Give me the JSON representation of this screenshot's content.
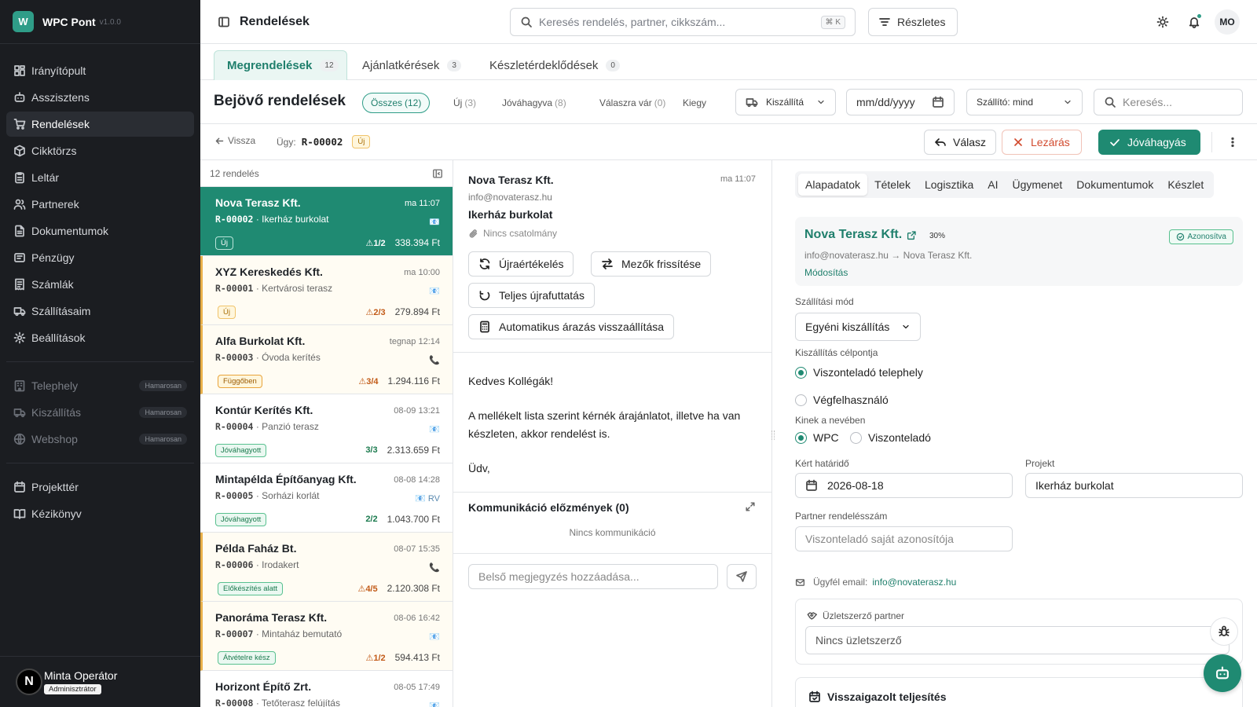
{
  "app": {
    "logo_letter": "W",
    "name": "WPC Pont",
    "version": "v1.0.0",
    "accent": "#1f8a72"
  },
  "sidebar": {
    "items": [
      {
        "label": "Irányítópult",
        "icon": "dashboard-icon"
      },
      {
        "label": "Asszisztens",
        "icon": "bot-icon"
      },
      {
        "label": "Rendelések",
        "icon": "cart-icon",
        "active": true
      },
      {
        "label": "Cikktörzs",
        "icon": "box-icon"
      },
      {
        "label": "Leltár",
        "icon": "clipboard-icon"
      },
      {
        "label": "Partnerek",
        "icon": "users-icon"
      },
      {
        "label": "Dokumentumok",
        "icon": "file-icon"
      },
      {
        "label": "Pénzügy",
        "icon": "wallet-icon"
      },
      {
        "label": "Számlák",
        "icon": "receipt-icon"
      },
      {
        "label": "Szállításaim",
        "icon": "truck-icon"
      },
      {
        "label": "Beállítások",
        "icon": "gear-icon"
      }
    ],
    "soon_items": [
      {
        "label": "Telephely",
        "badge": "Hamarosan"
      },
      {
        "label": "Kiszállítás",
        "badge": "Hamarosan"
      },
      {
        "label": "Webshop",
        "badge": "Hamarosan"
      }
    ],
    "extra_items": [
      {
        "label": "Projekttér"
      },
      {
        "label": "Kézikönyv"
      }
    ],
    "user": {
      "initial": "N",
      "name": "Minta Operátor",
      "role": "Adminisztrátor"
    }
  },
  "topbar": {
    "title": "Rendelések",
    "search_placeholder": "Keresés rendelés, partner, cikkszám...",
    "shortcut": "⌘ K",
    "advanced": "Részletes",
    "user_initials": "MO"
  },
  "tabs": [
    {
      "label": "Megrendelések",
      "count": "12"
    },
    {
      "label": "Ajánlatkérések",
      "count": "3"
    },
    {
      "label": "Készletérdeklődések",
      "count": "0"
    }
  ],
  "filters": {
    "title": "Bejövő rendelések",
    "chips": [
      {
        "label": "Összes",
        "count": "(12)"
      },
      {
        "label": "Új",
        "count": "(3)"
      },
      {
        "label": "Jóváhagyva",
        "count": "(8)"
      },
      {
        "label": "Válaszra vár",
        "count": "(0)"
      },
      {
        "label": "Kiegy",
        "count": ""
      }
    ],
    "delivery": "Kiszállítá",
    "date_placeholder": "mm/dd/yyyy",
    "carrier": "Szállító: mind",
    "search_placeholder": "Keresés..."
  },
  "detail_header": {
    "back": "Vissza",
    "case_label": "Ügy:",
    "case_id": "R-00002",
    "status": "Új",
    "reply": "Válasz",
    "close": "Lezárás",
    "approve": "Jóváhagyás"
  },
  "list": {
    "count_label": "12 rendelés",
    "rows": [
      {
        "name": "Nova Terasz Kft.",
        "time": "ma 11:07",
        "id": "R-00002",
        "desc": "· Ikerház burkolat",
        "channel": "📧",
        "status": "Új",
        "warn": "⚠1/2",
        "amount": "338.394 Ft"
      },
      {
        "name": "XYZ Kereskedés Kft.",
        "time": "ma 10:00",
        "id": "R-00001",
        "desc": "· Kertvárosi terasz",
        "channel": "📧",
        "status": "Új",
        "warn": "⚠2/3",
        "amount": "279.894 Ft"
      },
      {
        "name": "Alfa Burkolat Kft.",
        "time": "tegnap 12:14",
        "id": "R-00003",
        "desc": "· Óvoda kerítés",
        "channel": "📞",
        "status": "Függőben",
        "warn": "⚠3/4",
        "amount": "1.294.116 Ft"
      },
      {
        "name": "Kontúr Kerítés Kft.",
        "time": "08-09 13:21",
        "id": "R-00004",
        "desc": "· Panzió terasz",
        "channel": "📧",
        "status": "Jóváhagyott",
        "warn": "3/3",
        "amount": "2.313.659 Ft"
      },
      {
        "name": "Mintapélda Építőanyag Kft.",
        "time": "08-08 14:28",
        "id": "R-00005",
        "desc": "· Sorházi korlát",
        "channel": "📧 RV",
        "status": "Jóváhagyott",
        "warn": "2/2",
        "amount": "1.043.700 Ft"
      },
      {
        "name": "Példa Faház Bt.",
        "time": "08-07 15:35",
        "id": "R-00006",
        "desc": "· Irodakert",
        "channel": "📞",
        "status": "Előkészítés alatt",
        "warn": "⚠4/5",
        "amount": "2.120.308 Ft"
      },
      {
        "name": "Panoráma Terasz Kft.",
        "time": "08-06 16:42",
        "id": "R-00007",
        "desc": "· Mintaház bemutató",
        "channel": "📧",
        "status": "Átvételre kész",
        "warn": "⚠1/2",
        "amount": "594.413 Ft"
      },
      {
        "name": "Horizont Építő Zrt.",
        "time": "08-05 17:49",
        "id": "R-00008",
        "desc": "· Tetőterasz felújítás",
        "channel": "📧",
        "status": "",
        "warn": "",
        "amount": ""
      }
    ]
  },
  "message": {
    "from": "Nova Terasz Kft.",
    "time": "ma 11:07",
    "email": "info@novaterasz.hu",
    "subject": "Ikerház burkolat",
    "attachments": "Nincs csatolmány",
    "actions": [
      "Újraértékelés",
      "Mezők frissítése",
      "Teljes újrafuttatás",
      "Automatikus árazás visszaállítása"
    ],
    "body": [
      "Kedves Kollégák!",
      "A mellékelt lista szerint kérnék árajánlatot, illetve ha van készleten, akkor rendelést is.",
      "Üdv,"
    ],
    "comm_title": "Kommunikáció előzmények (0)",
    "comm_empty": "Nincs kommunikáció",
    "note_placeholder": "Belső megjegyzés hozzáadása..."
  },
  "detail": {
    "tabs": [
      "Alapadatok",
      "Tételek",
      "Logisztika",
      "AI",
      "Ügymenet",
      "Dokumentumok",
      "Készlet"
    ],
    "partner": {
      "name": "Nova Terasz Kft.",
      "confidence": "30%",
      "identified": "Azonosítva",
      "mapping": "info@novaterasz.hu → Nova Terasz Kft.",
      "modify": "Módosítás"
    },
    "shipping_label": "Szállítási mód",
    "shipping_value": "Egyéni kiszállítás",
    "target_label": "Kiszállítás célpontja",
    "target_options": [
      "Viszonteladó telephely",
      "Végfelhasználó"
    ],
    "behalf_label": "Kinek a nevében",
    "behalf_options": [
      "WPC",
      "Viszonteladó"
    ],
    "deadline_label": "Kért határidő",
    "deadline_value": "2026-08-18",
    "project_label": "Projekt",
    "project_value": "Ikerház burkolat",
    "partner_order_label": "Partner rendelésszám",
    "partner_order_placeholder": "Viszonteladó saját azonosítója",
    "customer_email_label": "Ügyfél email:",
    "customer_email": "info@novaterasz.hu",
    "broker_label": "Üzletszerző partner",
    "broker_value": "Nincs üzletszerző",
    "confirmed_label": "Visszaigazolt teljesítés"
  }
}
